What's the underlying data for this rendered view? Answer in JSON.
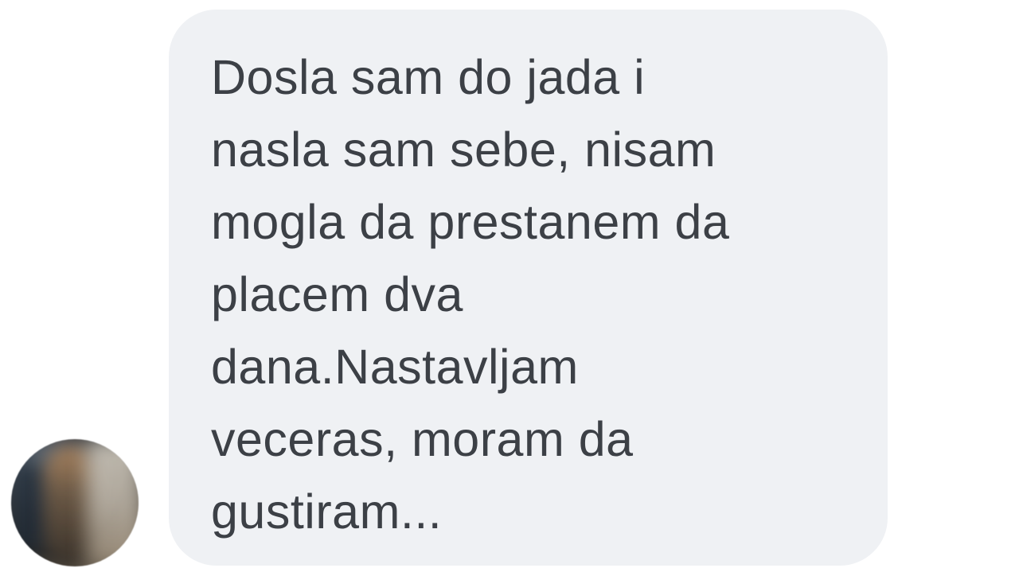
{
  "conversation": {
    "message": {
      "sender_avatar": "avatar-blurred",
      "lines": [
        "Dosla sam do jada i",
        "nasla sam sebe, nisam",
        "mogla da prestanem da",
        "placem dva",
        "dana.Nastavljam",
        "veceras, moram da",
        "gustiram..."
      ]
    },
    "colors": {
      "bubble": "#eff1f4",
      "text": "#3c4046",
      "background": "#ffffff"
    }
  }
}
